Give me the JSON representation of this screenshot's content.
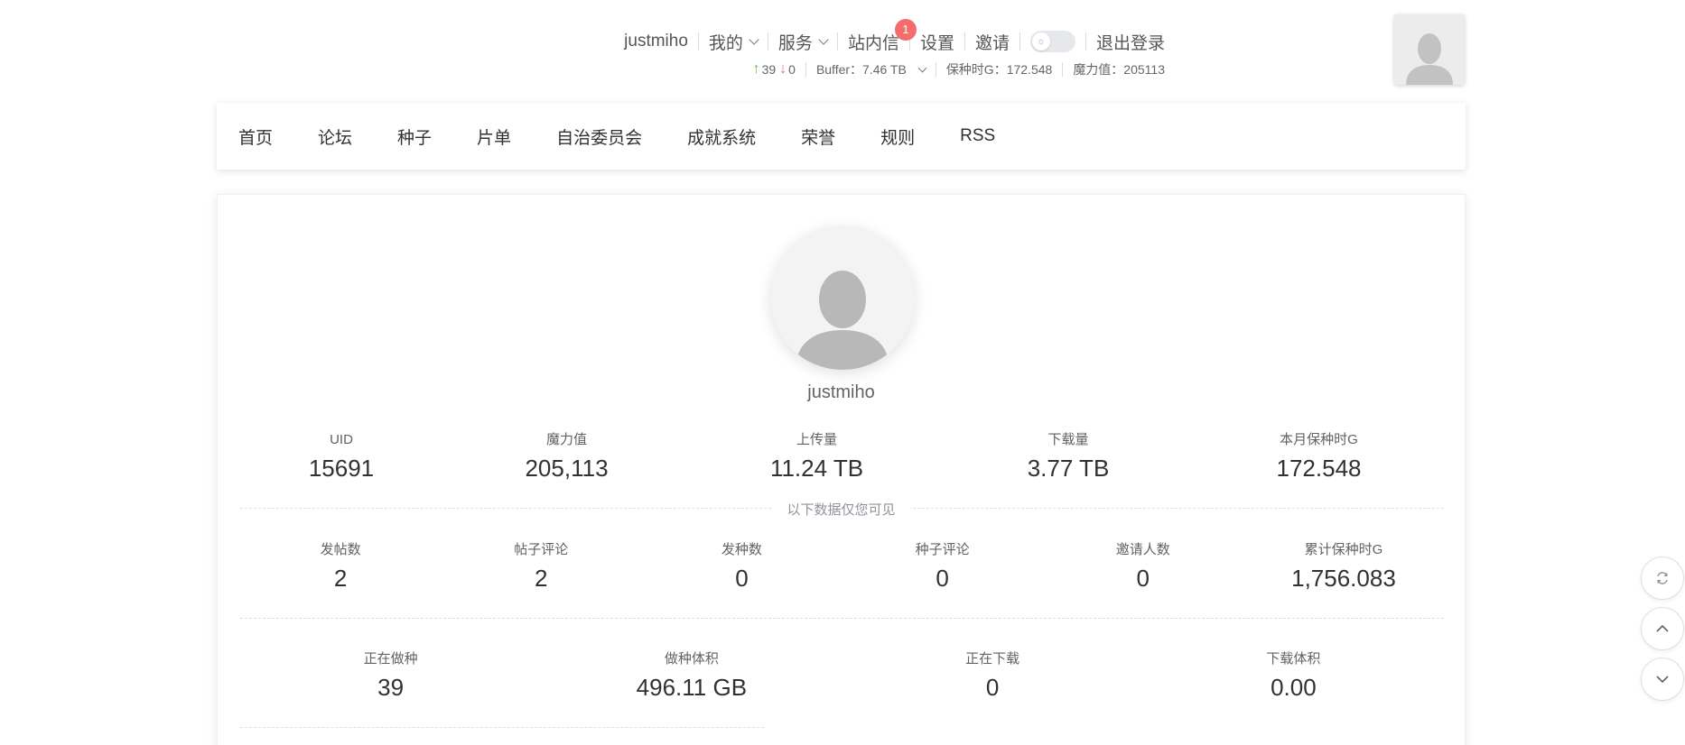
{
  "topbar": {
    "username": "justmiho",
    "my_label": "我的",
    "service_label": "服务",
    "messages_label": "站内信",
    "messages_badge": "1",
    "settings_label": "设置",
    "invite_label": "邀请",
    "logout_label": "退出登录",
    "theme_toggle_on": false
  },
  "stats_line": {
    "seeding_count": "39",
    "leeching_count": "0",
    "buffer": "Buffer：7.46 TB",
    "seed_time": "保种时G：172.548",
    "magic": "魔力值：205113"
  },
  "nav": {
    "items": [
      "首页",
      "论坛",
      "种子",
      "片单",
      "自治委员会",
      "成就系统",
      "荣誉",
      "规则",
      "RSS"
    ]
  },
  "profile": {
    "username": "justmiho",
    "row1": [
      {
        "label": "UID",
        "value": "15691"
      },
      {
        "label": "魔力值",
        "value": "205,113"
      },
      {
        "label": "上传量",
        "value": "11.24 TB"
      },
      {
        "label": "下载量",
        "value": "3.77 TB"
      },
      {
        "label": "本月保种时G",
        "value": "172.548"
      }
    ],
    "private_divider_text": "以下数据仅您可见",
    "row2": [
      {
        "label": "发帖数",
        "value": "2"
      },
      {
        "label": "帖子评论",
        "value": "2"
      },
      {
        "label": "发种数",
        "value": "0"
      },
      {
        "label": "种子评论",
        "value": "0"
      },
      {
        "label": "邀请人数",
        "value": "0"
      },
      {
        "label": "累计保种时G",
        "value": "1,756.083"
      }
    ],
    "row3": [
      {
        "label": "正在做种",
        "value": "39"
      },
      {
        "label": "做种体积",
        "value": "496.11 GB"
      },
      {
        "label": "正在下载",
        "value": "0"
      },
      {
        "label": "下载体积",
        "value": "0.00"
      }
    ]
  },
  "side_buttons": [
    "refresh-icon",
    "arrow-up-icon",
    "arrow-down-icon"
  ]
}
